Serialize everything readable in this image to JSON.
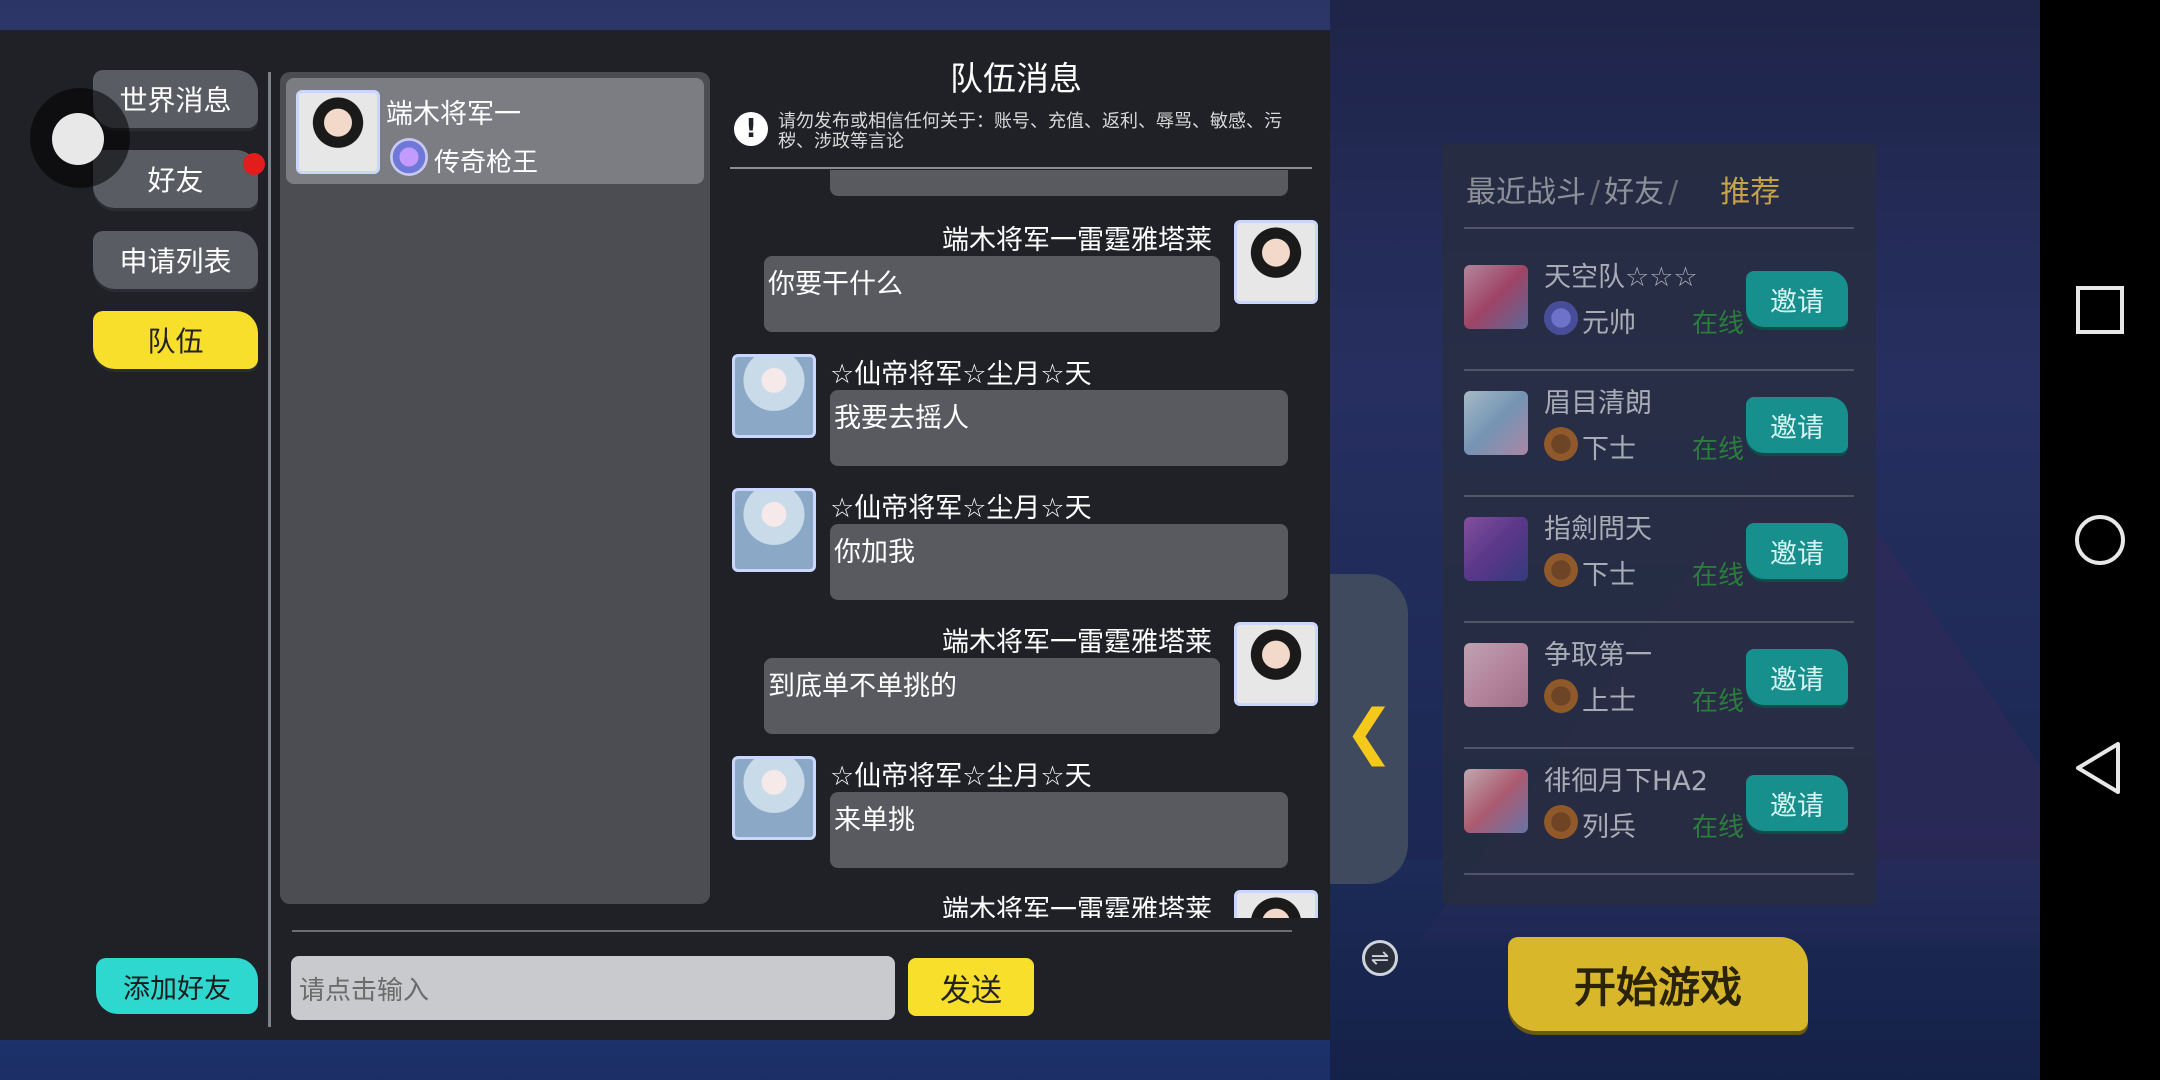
{
  "sidebar": {
    "tabs": [
      {
        "label": "世界消息",
        "active": false
      },
      {
        "label": "好友",
        "active": false,
        "badge": true
      },
      {
        "label": "申请列表",
        "active": false
      },
      {
        "label": "队伍",
        "active": true
      }
    ],
    "add_friend_label": "添加好友"
  },
  "friend_list": [
    {
      "name": "端木将军一",
      "rank": "传奇枪王"
    }
  ],
  "chat": {
    "title": "队伍消息",
    "warning": "请勿发布或相信任何关于：账号、充值、返利、辱骂、敏感、污秽、涉政等言论",
    "messages": [
      {
        "sender": "端木将军一雷霆雅塔莱",
        "text": "你要干什么",
        "self": true
      },
      {
        "sender": "☆仙帝将军☆尘月☆天",
        "text": "我要去摇人",
        "self": false
      },
      {
        "sender": "☆仙帝将军☆尘月☆天",
        "text": "你加我",
        "self": false
      },
      {
        "sender": "端木将军一雷霆雅塔莱",
        "text": "到底单不单挑的",
        "self": true
      },
      {
        "sender": "☆仙帝将军☆尘月☆天",
        "text": "来单挑",
        "self": false
      },
      {
        "sender": "端木将军一雷霆雅塔莱",
        "text": "",
        "self": true
      }
    ],
    "input_placeholder": "请点击输入",
    "send_label": "发送"
  },
  "recommend": {
    "tabs": [
      "最近战斗",
      "好友",
      "推荐"
    ],
    "active_tab": "推荐",
    "players": [
      {
        "name": "天空队☆☆☆",
        "rank": "元帅",
        "status": "在线",
        "invite": "邀请"
      },
      {
        "name": "眉目清朗",
        "rank": "下士",
        "status": "在线",
        "invite": "邀请"
      },
      {
        "name": "指劍問天",
        "rank": "下士",
        "status": "在线",
        "invite": "邀请"
      },
      {
        "name": "争取第一",
        "rank": "上士",
        "status": "在线",
        "invite": "邀请"
      },
      {
        "name": "徘徊月下HA2",
        "rank": "列兵",
        "status": "在线",
        "invite": "邀请"
      }
    ]
  },
  "start_game_label": "开始游戏",
  "colors": {
    "accent_yellow": "#f7df2c",
    "teal": "#2ed8cf",
    "panel": "#1f2126"
  }
}
